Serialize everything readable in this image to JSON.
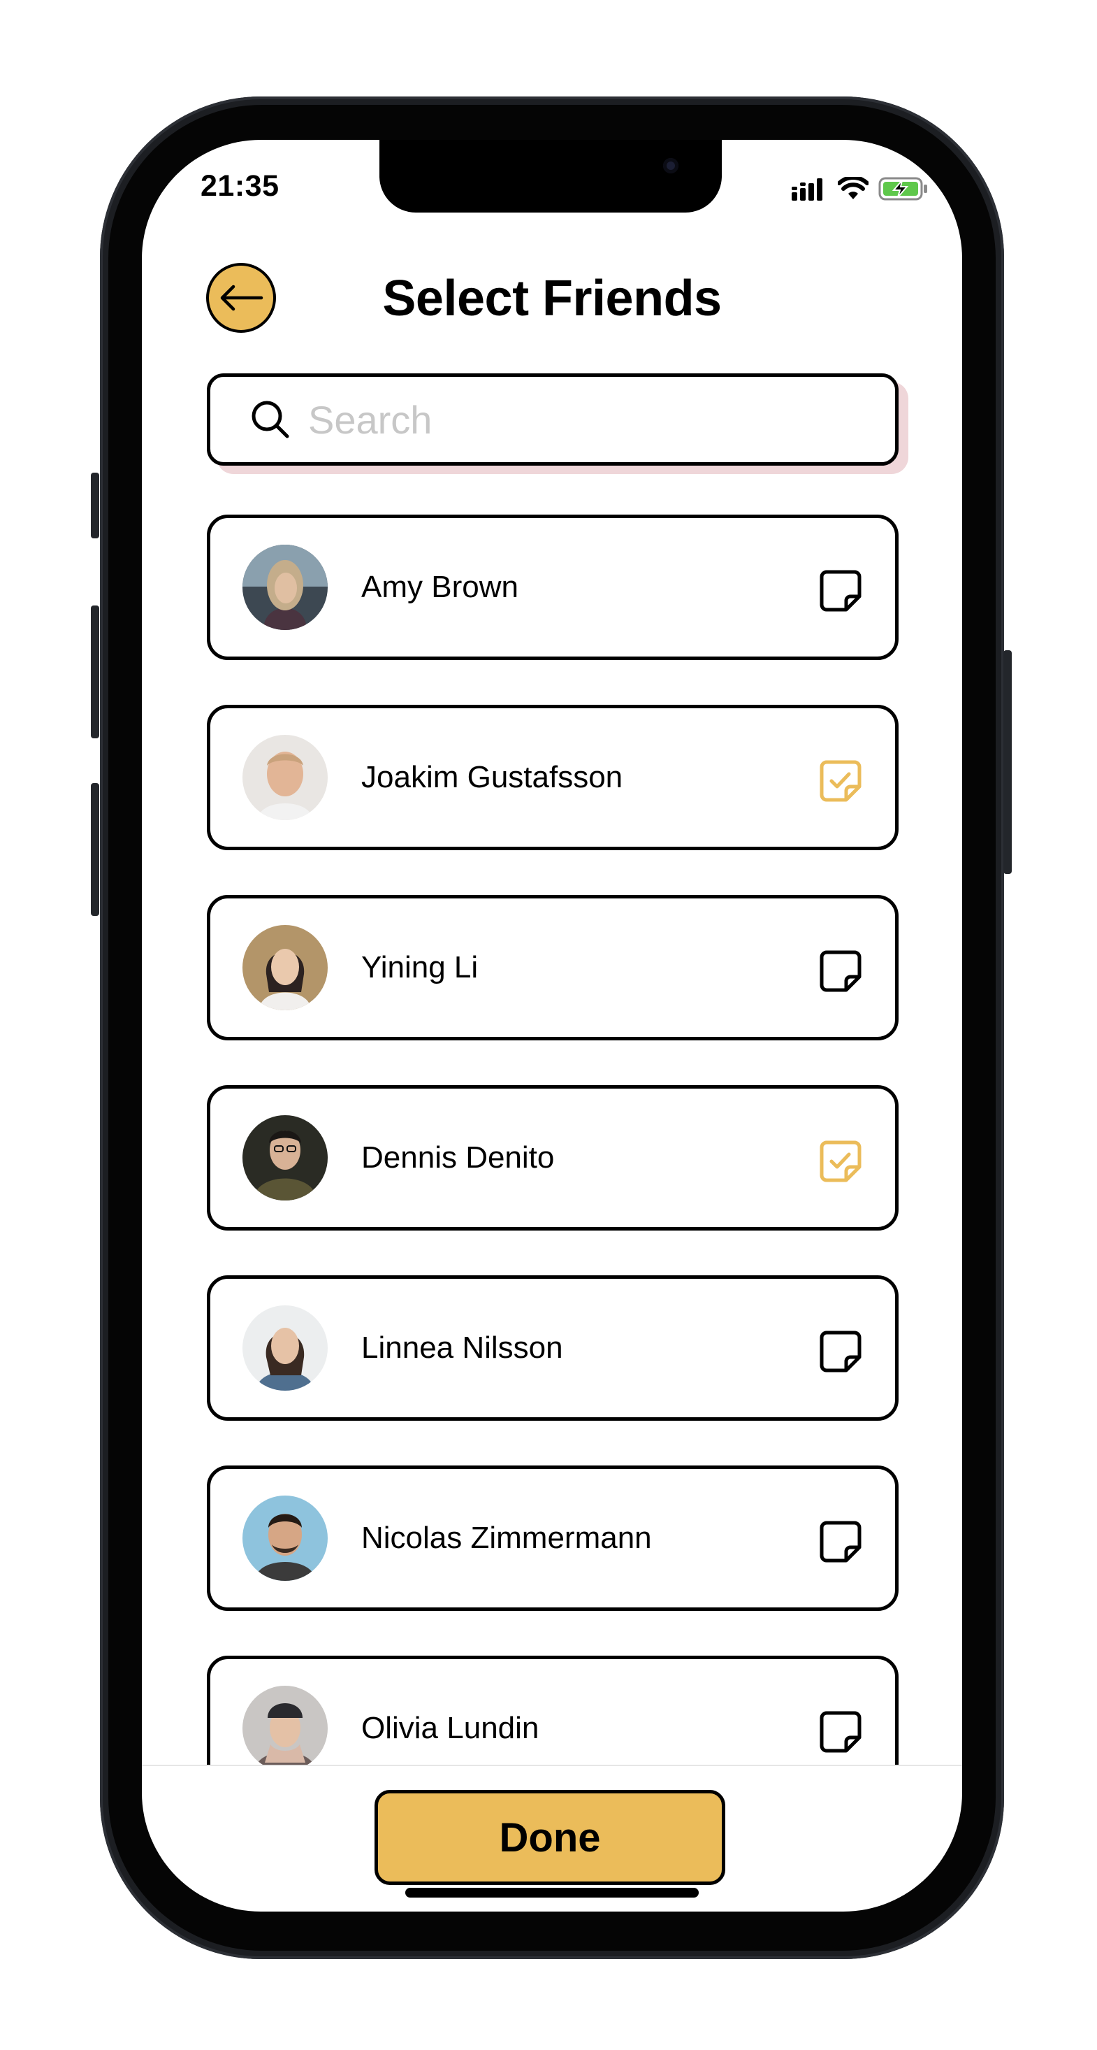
{
  "status_bar": {
    "time": "21:35"
  },
  "header": {
    "title": "Select Friends"
  },
  "search": {
    "placeholder": "Search",
    "value": ""
  },
  "friends": [
    {
      "name": "Amy Brown",
      "selected": false,
      "avatar_tone": "#6d6a63"
    },
    {
      "name": "Joakim Gustafsson",
      "selected": true,
      "avatar_tone": "#d8c3b3"
    },
    {
      "name": "Yining Li",
      "selected": false,
      "avatar_tone": "#a68a62"
    },
    {
      "name": "Dennis Denito",
      "selected": true,
      "avatar_tone": "#3c3a30"
    },
    {
      "name": "Linnea Nilsson",
      "selected": false,
      "avatar_tone": "#cfd2d4"
    },
    {
      "name": "Nicolas Zimmermann",
      "selected": false,
      "avatar_tone": "#7fb6cf"
    },
    {
      "name": "Olivia Lundin",
      "selected": false,
      "avatar_tone": "#a9a6a6"
    }
  ],
  "actions": {
    "done_label": "Done"
  },
  "colors": {
    "accent": "#ebbc5a",
    "text": "#000000",
    "search_shadow": "#efd6d9",
    "checkbox_selected": "#ebbc5a"
  }
}
